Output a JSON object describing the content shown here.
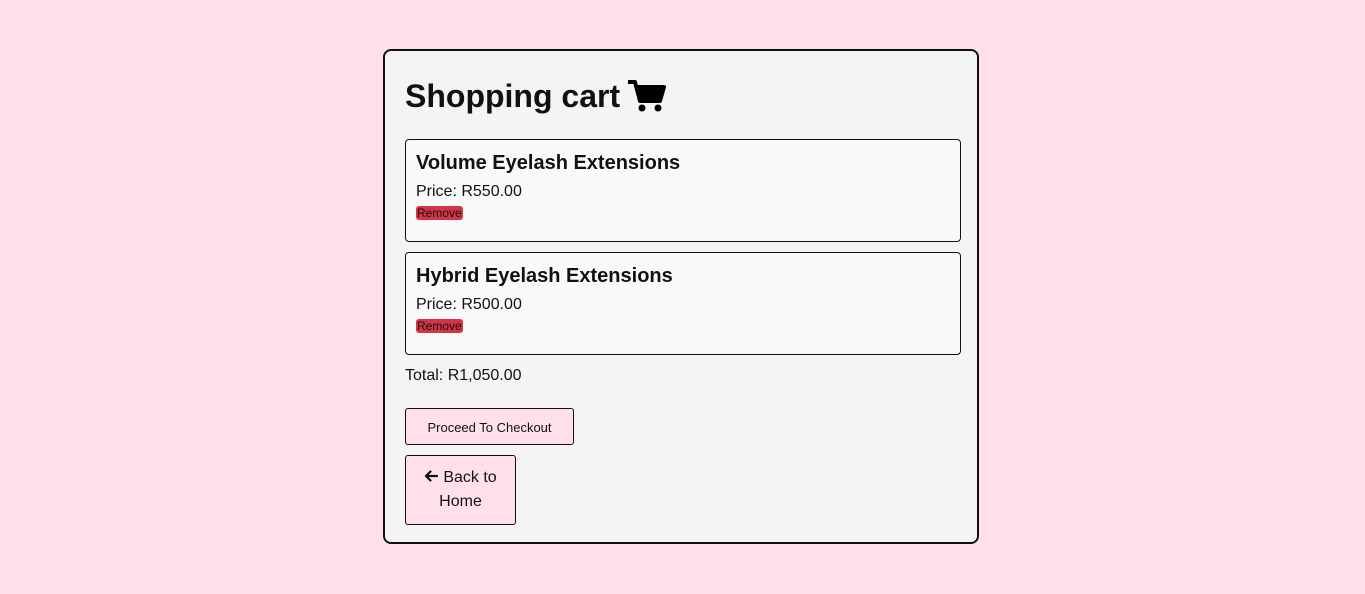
{
  "cart": {
    "title": "Shopping cart",
    "icon": "shopping-cart-icon",
    "items": [
      {
        "name": "Volume Eyelash Extensions",
        "price": "Price: R550.00",
        "remove_label": "Remove"
      },
      {
        "name": "Hybrid Eyelash Extensions",
        "price": "Price: R500.00",
        "remove_label": "Remove"
      }
    ],
    "total": "Total: R1,050.00",
    "checkout_label": "Proceed To Checkout",
    "back_line1": "Back to",
    "back_line2": "Home",
    "back_icon": "arrow-left-icon"
  },
  "colors": {
    "page_background": "#ffe0e8",
    "panel_background": "#f4f4f4",
    "remove_button": "#d63346",
    "button_background": "#ffe0e8"
  }
}
